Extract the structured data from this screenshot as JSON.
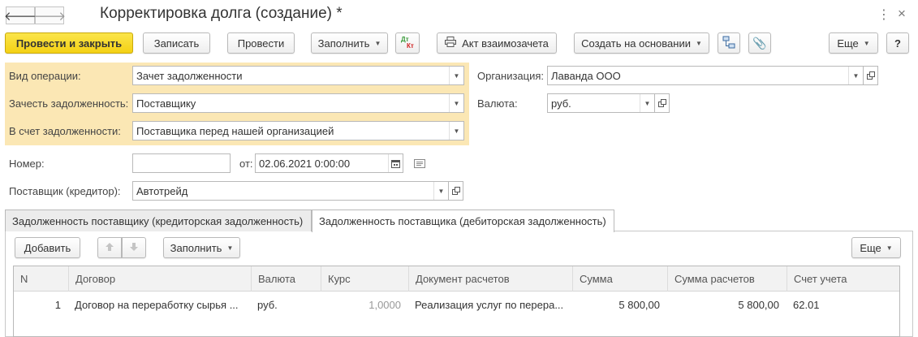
{
  "window": {
    "title": "Корректировка долга (создание) *"
  },
  "nav": {
    "back_icon": "arrow-left-icon",
    "forward_icon": "arrow-right-icon",
    "back_glyph": "🡐",
    "forward_glyph": "🡒",
    "more_glyph": "⋮",
    "close_glyph": "×"
  },
  "toolbar": {
    "post_close_label": "Провести и закрыть",
    "save_label": "Записать",
    "post_label": "Провести",
    "fill_label": "Заполнить",
    "dtkt_top": "Дт",
    "dtkt_bottom": "Кт",
    "print_act_label": "Акт взаимозачета",
    "create_based_label": "Создать на основании",
    "more_label": "Еще",
    "help_label": "?"
  },
  "form": {
    "operation_type": {
      "label": "Вид операции:",
      "value": "Зачет задолженности"
    },
    "offset_debt": {
      "label": "Зачесть задолженность:",
      "value": "Поставщику"
    },
    "against_debt": {
      "label": "В счет задолженности:",
      "value": "Поставщика перед нашей организацией"
    },
    "organization": {
      "label": "Организация:",
      "value": "Лаванда ООО"
    },
    "currency": {
      "label": "Валюта:",
      "value": "руб."
    },
    "number": {
      "label": "Номер:",
      "value": ""
    },
    "date": {
      "label": "от:",
      "value": "02.06.2021  0:00:00"
    },
    "supplier": {
      "label": "Поставщик (кредитор):",
      "value": "Автотрейд"
    }
  },
  "tabs": [
    {
      "label": "Задолженность поставщику (кредиторская задолженность)",
      "active": false
    },
    {
      "label": "Задолженность поставщика (дебиторская задолженность)",
      "active": true
    }
  ],
  "table_toolbar": {
    "add_label": "Добавить",
    "fill_label": "Заполнить",
    "more_label": "Еще"
  },
  "table": {
    "columns": [
      "N",
      "Договор",
      "Валюта",
      "Курс",
      "Документ расчетов",
      "Сумма",
      "Сумма расчетов",
      "Счет учета"
    ],
    "rows": [
      {
        "n": "1",
        "contract": "Договор на переработку сырья ...",
        "currency": "руб.",
        "rate": "1,0000",
        "document": "Реализация услуг по перера...",
        "amount": "5 800,00",
        "settlement_amount": "5 800,00",
        "account": "62.01"
      }
    ]
  },
  "colors": {
    "primary_button": "#f4d114",
    "panel_highlight": "#fbe7b4",
    "green_icon": "#3a9a3a",
    "red_icon": "#d02020"
  }
}
